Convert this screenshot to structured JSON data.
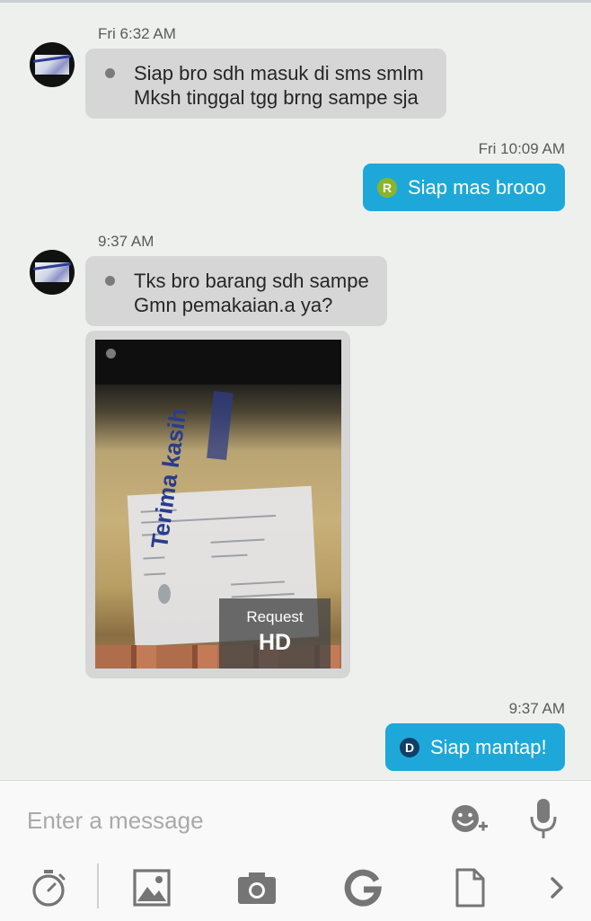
{
  "messages": [
    {
      "time": "Fri 6:32 AM",
      "direction": "incoming",
      "lines": [
        "Siap bro sdh masuk di sms smlm",
        "Mksh tinggal tgg brng sampe sja"
      ]
    },
    {
      "time": "Fri 10:09 AM",
      "direction": "outgoing",
      "badge": "R",
      "badge_color": "#8ab529",
      "text": "Siap mas brooo"
    },
    {
      "time": "9:37 AM",
      "direction": "incoming",
      "lines": [
        "Tks bro barang sdh sampe",
        "Gmn pemakaian.a ya?"
      ]
    },
    {
      "direction": "incoming",
      "type": "image",
      "request": {
        "line1": "Request",
        "line2": "HD"
      }
    },
    {
      "time": "9:37 AM",
      "direction": "outgoing",
      "badge": "D",
      "badge_color": "#123f66",
      "text": "Siap mantap!"
    }
  ],
  "composer": {
    "placeholder": "Enter a message",
    "icons": [
      "emoji-plus-icon",
      "microphone-icon"
    ],
    "toolbar": [
      "timer-icon",
      "gallery-icon",
      "camera-icon",
      "google-icon",
      "file-icon",
      "chevron-right-icon"
    ]
  },
  "colors": {
    "background": "#eef0ee",
    "incoming_bubble": "#d6d6d6",
    "outgoing_bubble": "#1ea8d9",
    "icon_gray": "#757575"
  }
}
